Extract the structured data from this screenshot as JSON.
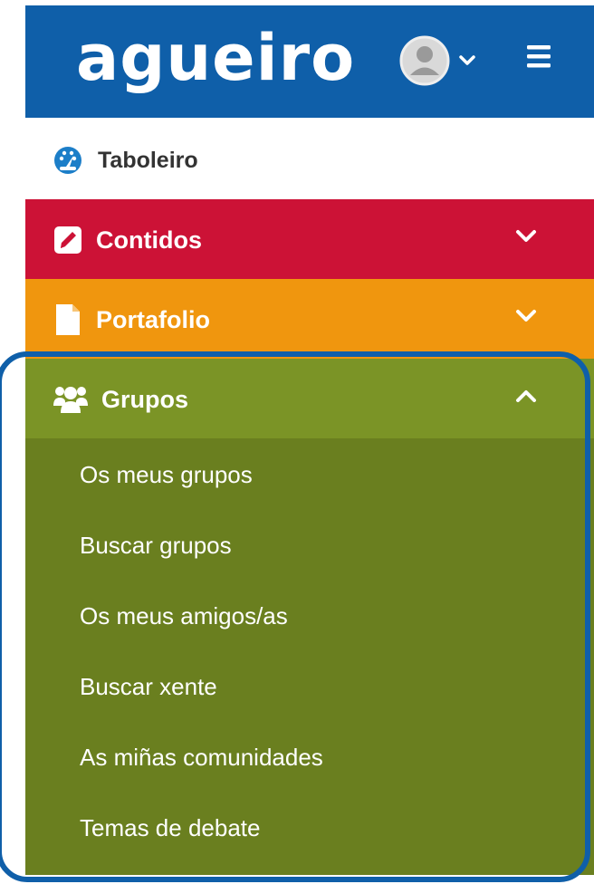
{
  "header": {
    "logo_text": "agueiro",
    "brand_color": "#0f5fa9",
    "user_menu_icon": "user-avatar-icon",
    "user_menu_chevron": "chevron-down-icon",
    "menu_icon": "hamburger-icon"
  },
  "nav": {
    "items": [
      {
        "label": "Taboleiro",
        "icon": "dashboard-gauge-icon",
        "color": "#ffffff"
      },
      {
        "label": "Contidos",
        "icon": "edit-square-icon",
        "color": "#cc1236",
        "expanded": false
      },
      {
        "label": "Portafolio",
        "icon": "file-icon",
        "color": "#f0960e",
        "expanded": false
      },
      {
        "label": "Grupos",
        "icon": "users-group-icon",
        "color": "#7b9426",
        "expanded": true,
        "subitems": [
          "Os meus grupos",
          "Buscar grupos",
          "Os meus amigos/as",
          "Buscar xente",
          "As miñas comunidades",
          "Temas de debate"
        ]
      }
    ]
  },
  "highlight_color": "#0f5fa9"
}
